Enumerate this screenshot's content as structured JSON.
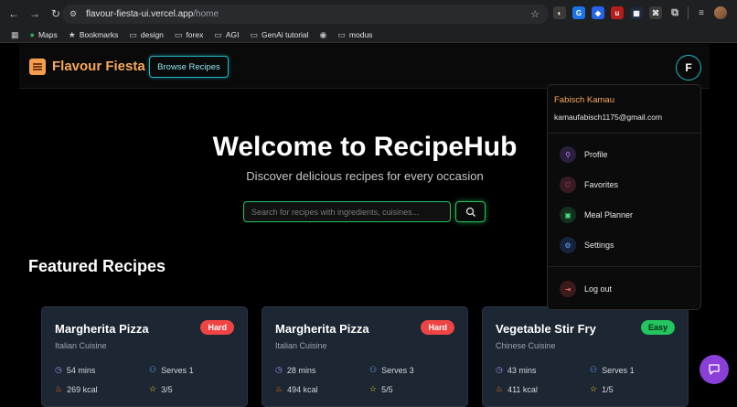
{
  "browser": {
    "url_host": "flavour-fiesta-ui.vercel.app",
    "url_path": "/home",
    "bookmarks": [
      "Maps",
      "Bookmarks",
      "design",
      "forex",
      "AGI",
      "GenAi tutorial",
      "modus"
    ]
  },
  "navbar": {
    "logo_text": "Flavour Fiesta",
    "browse_label": "Browse Recipes",
    "avatar_initial": "F"
  },
  "hero": {
    "title": "Welcome to RecipeHub",
    "subtitle": "Discover delicious recipes for every occasion",
    "search_placeholder": "Search for recipes with ingredients, cuisines..."
  },
  "featured": {
    "title": "Featured Recipes",
    "cards": [
      {
        "name": "Margherita Pizza",
        "cuisine": "Italian Cuisine",
        "difficulty": "Hard",
        "time": "54 mins",
        "serves": "Serves 1",
        "kcal": "269 kcal",
        "rating": "3/5"
      },
      {
        "name": "Margherita Pizza",
        "cuisine": "Italian Cuisine",
        "difficulty": "Hard",
        "time": "28 mins",
        "serves": "Serves 3",
        "kcal": "494 kcal",
        "rating": "5/5"
      },
      {
        "name": "Vegetable Stir Fry",
        "cuisine": "Chinese Cuisine",
        "difficulty": "Easy",
        "time": "43 mins",
        "serves": "Serves 1",
        "kcal": "411 kcal",
        "rating": "1/5"
      }
    ]
  },
  "user_menu": {
    "name": "Fabisch Kamau",
    "email": "kamaufabisch1175@gmail.com",
    "items": [
      "Profile",
      "Favorites",
      "Meal Planner",
      "Settings"
    ],
    "logout": "Log out"
  },
  "colors": {
    "accent_orange": "#f7a85b",
    "accent_cyan": "#22b8c9",
    "accent_green": "#22c55e",
    "hard": "#ef4444",
    "fab": "#8b3fd9"
  }
}
